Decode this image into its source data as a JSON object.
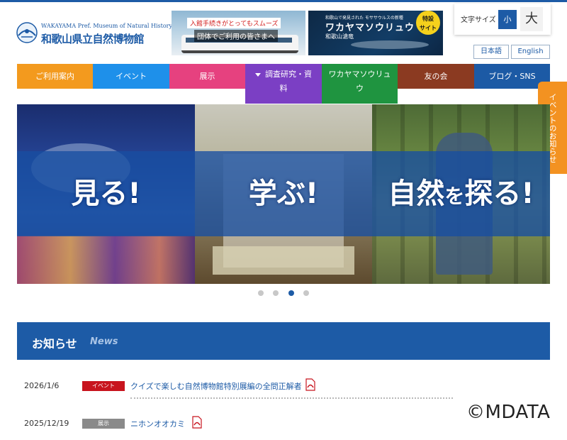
{
  "logo": {
    "en": "WAKAYAMA Pref. Museum of Natural History",
    "ja": "和歌山県立自然博物館"
  },
  "banners": {
    "transit": {
      "caption_top": "入館手続きがとってもスムーズ",
      "caption_bottom": "団体でご利用の皆さまへ"
    },
    "feature": {
      "sub": "和歌山で発見された モササウルスの新種",
      "title": "ワカヤマソウリュウ",
      "small": "和歌山滄竜",
      "badge_line1": "特設",
      "badge_line2": "サイト"
    }
  },
  "font_size": {
    "label": "文字サイズ",
    "small": "小",
    "large": "大"
  },
  "languages": [
    "日本語",
    "English"
  ],
  "nav": [
    {
      "label": "ご利用案内",
      "color": "#f39a1e"
    },
    {
      "label": "イベント",
      "color": "#1e90ea"
    },
    {
      "label": "展示",
      "color": "#e6417f"
    },
    {
      "label": "調査研究・資",
      "label2": "料",
      "color": "#7b3fc4"
    },
    {
      "label": "ワカヤマソウリュ",
      "label2": "ウ",
      "color": "#1f9440"
    },
    {
      "label": "友の会",
      "color": "#8b3a21"
    },
    {
      "label": "ブログ・SNS",
      "color": "#1c5aa5"
    }
  ],
  "side_tab": "イベントのお知らせ",
  "hero": {
    "words": [
      "見る!",
      "学ぶ!",
      "自然",
      "を",
      "探る!"
    ],
    "active_slide": 3,
    "slide_count": 4
  },
  "news": {
    "title": "お知らせ",
    "subtitle": "News",
    "items": [
      {
        "date": "2026/1/6",
        "category": "イベント",
        "category_color": "#c8141e",
        "text": "クイズで楽しむ自然博物館特別展編の全問正解者",
        "has_pdf": true
      },
      {
        "date": "2025/12/19",
        "category": "展示",
        "category_color": "#8a8a8a",
        "text": "ニホンオオカミ",
        "has_pdf": true
      }
    ]
  },
  "copyright": "©MDATA"
}
